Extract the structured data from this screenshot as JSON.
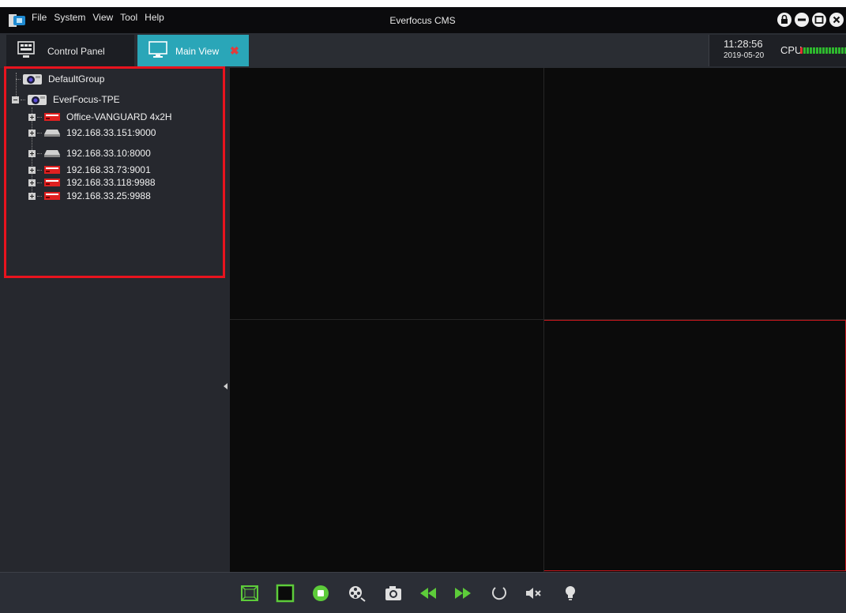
{
  "app": {
    "title": "Everfocus CMS",
    "menu": [
      "File",
      "System",
      "View",
      "Tool",
      "Help"
    ]
  },
  "tabs": {
    "control_panel": "Control Panel",
    "main_view": "Main View"
  },
  "status": {
    "time": "11:28:56",
    "date": "2019-05-20",
    "cpu_label": "CPU"
  },
  "tree": {
    "groups": [
      {
        "label": "DefaultGroup",
        "expanded": false,
        "devices": []
      },
      {
        "label": "EverFocus-TPE",
        "expanded": true,
        "devices": [
          {
            "label": "Office-VANGUARD 4x2H",
            "type": "dvr-red"
          },
          {
            "label": "192.168.33.151:9000",
            "type": "nvr-silver"
          },
          {
            "label": "192.168.33.10:8000",
            "type": "nvr-silver"
          },
          {
            "label": "192.168.33.73:9001",
            "type": "dvr-red"
          },
          {
            "label": "192.168.33.118:9988",
            "type": "dvr-red"
          },
          {
            "label": "192.168.33.25:9988",
            "type": "dvr-red"
          }
        ]
      }
    ]
  },
  "view": {
    "layout": "2x2",
    "selected_cell": 4
  },
  "toolbar": {
    "buttons": [
      "fullscreen-icon",
      "single-view-icon",
      "stop-icon",
      "record-icon",
      "snapshot-icon",
      "rewind-icon",
      "fast-forward-icon",
      "cycle-icon",
      "mute-icon",
      "light-icon"
    ]
  },
  "colors": {
    "accent": "#2aa6b8",
    "highlight": "#e8131e",
    "panel": "#26282e",
    "video_bg": "#0b0b0b"
  }
}
